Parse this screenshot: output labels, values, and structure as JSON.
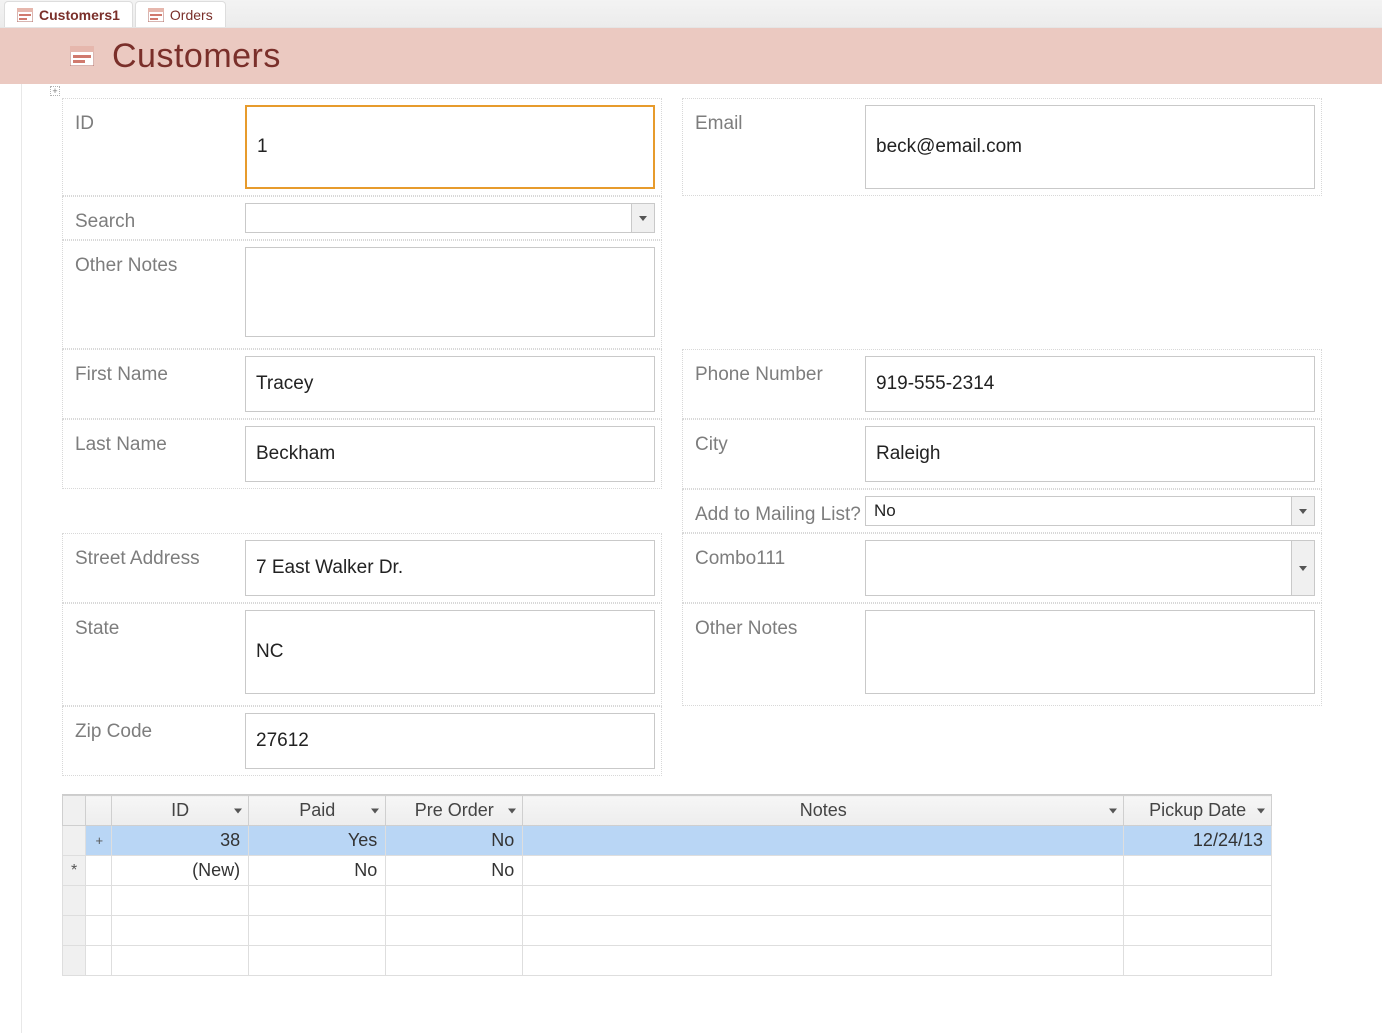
{
  "tabs": [
    {
      "label": "Customers1",
      "active": true
    },
    {
      "label": "Orders",
      "active": false
    }
  ],
  "header": {
    "title": "Customers"
  },
  "fields": {
    "id": {
      "label": "ID",
      "value": "1"
    },
    "email": {
      "label": "Email",
      "value": "beck@email.com"
    },
    "search": {
      "label": "Search",
      "value": ""
    },
    "otherNotes1": {
      "label": "Other Notes",
      "value": ""
    },
    "firstName": {
      "label": "First Name",
      "value": "Tracey"
    },
    "phone": {
      "label": "Phone Number",
      "value": "919-555-2314"
    },
    "lastName": {
      "label": "Last Name",
      "value": "Beckham"
    },
    "city": {
      "label": "City",
      "value": "Raleigh"
    },
    "mailing": {
      "label": "Add to Mailing List?",
      "value": "No"
    },
    "street": {
      "label": "Street Address",
      "value": "7 East Walker Dr."
    },
    "combo111": {
      "label": "Combo111",
      "value": ""
    },
    "state": {
      "label": "State",
      "value": "NC"
    },
    "otherNotes2": {
      "label": "Other Notes",
      "value": ""
    },
    "zip": {
      "label": "Zip Code",
      "value": "27612"
    }
  },
  "subsheet": {
    "columns": [
      "ID",
      "Paid",
      "Pre Order",
      "Notes",
      "Pickup Date"
    ],
    "rows": [
      {
        "selector": "",
        "expand": "+",
        "id": "38",
        "paid": "Yes",
        "pre": "No",
        "notes": "",
        "pickup": "12/24/13",
        "selected": true
      },
      {
        "selector": "*",
        "expand": "",
        "id": "(New)",
        "paid": "No",
        "pre": "No",
        "notes": "",
        "pickup": "",
        "selected": false
      }
    ]
  }
}
